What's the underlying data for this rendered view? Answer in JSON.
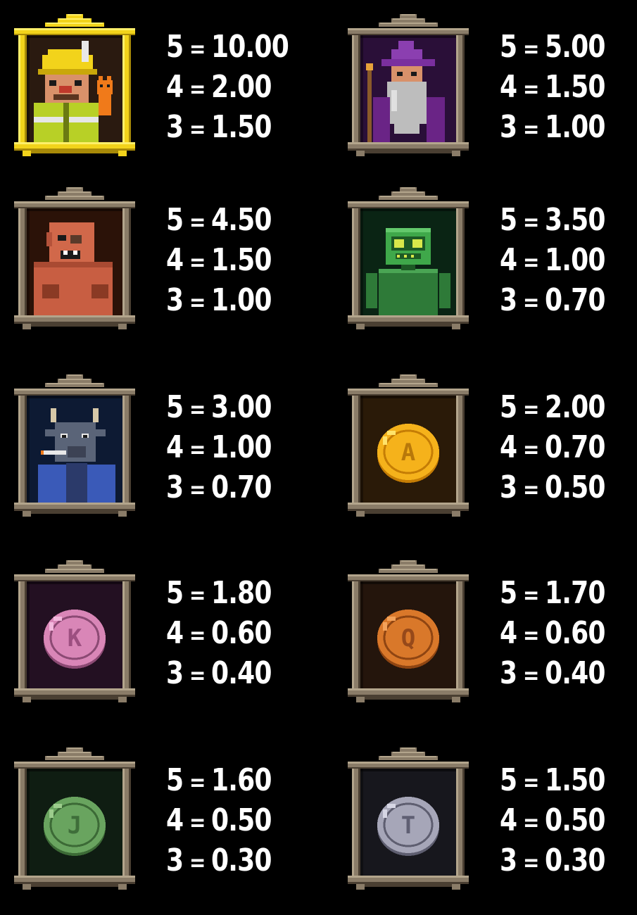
{
  "colors": {
    "background": "#000000",
    "text": "#ffffff",
    "frame_wood": "#8a7c68",
    "frame_wood_light": "#b3a58c",
    "frame_wood_dark": "#4a3f32",
    "frame_gold": "#f2d31b",
    "frame_gold_light": "#fff06a",
    "frame_gold_dark": "#a88a08"
  },
  "symbols": [
    {
      "id": "firefighter",
      "icon": "firefighter-with-cat-portrait",
      "frame": "gold",
      "panel_color": "#2a1a10",
      "pays": [
        {
          "count": "5",
          "eq": "=",
          "amount": "10.00"
        },
        {
          "count": "4",
          "eq": "=",
          "amount": "2.00"
        },
        {
          "count": "3",
          "eq": "=",
          "amount": "1.50"
        }
      ]
    },
    {
      "id": "wizard",
      "icon": "wizard-portrait",
      "frame": "wood",
      "panel_color": "#2a0f38",
      "pays": [
        {
          "count": "5",
          "eq": "=",
          "amount": "5.00"
        },
        {
          "count": "4",
          "eq": "=",
          "amount": "1.50"
        },
        {
          "count": "3",
          "eq": "=",
          "amount": "1.00"
        }
      ]
    },
    {
      "id": "ogre",
      "icon": "ogre-portrait",
      "frame": "wood",
      "panel_color": "#2b1208",
      "pays": [
        {
          "count": "5",
          "eq": "=",
          "amount": "4.50"
        },
        {
          "count": "4",
          "eq": "=",
          "amount": "1.50"
        },
        {
          "count": "3",
          "eq": "=",
          "amount": "1.00"
        }
      ]
    },
    {
      "id": "robot",
      "icon": "green-robot-portrait",
      "frame": "wood",
      "panel_color": "#0a2414",
      "pays": [
        {
          "count": "5",
          "eq": "=",
          "amount": "3.50"
        },
        {
          "count": "4",
          "eq": "=",
          "amount": "1.00"
        },
        {
          "count": "3",
          "eq": "=",
          "amount": "0.70"
        }
      ]
    },
    {
      "id": "goat",
      "icon": "goat-with-cigar-portrait",
      "frame": "wood",
      "panel_color": "#0d1a33",
      "pays": [
        {
          "count": "5",
          "eq": "=",
          "amount": "3.00"
        },
        {
          "count": "4",
          "eq": "=",
          "amount": "1.00"
        },
        {
          "count": "3",
          "eq": "=",
          "amount": "0.70"
        }
      ]
    },
    {
      "id": "coin-a",
      "icon": "gold-coin-a-icon",
      "frame": "wood",
      "panel_color": "#2a1a08",
      "coin": {
        "letter": "A",
        "fill": "#f5b21b",
        "rim": "#c57d05",
        "shine": "#ffe36a",
        "letter_color": "#b8780a"
      },
      "pays": [
        {
          "count": "5",
          "eq": "=",
          "amount": "2.00"
        },
        {
          "count": "4",
          "eq": "=",
          "amount": "0.70"
        },
        {
          "count": "3",
          "eq": "=",
          "amount": "0.50"
        }
      ]
    },
    {
      "id": "coin-k",
      "icon": "pink-coin-k-icon",
      "frame": "wood",
      "panel_color": "#231022",
      "coin": {
        "letter": "K",
        "fill": "#d986b7",
        "rim": "#8c4a74",
        "shine": "#f3b8dd",
        "letter_color": "#9c4f80"
      },
      "pays": [
        {
          "count": "5",
          "eq": "=",
          "amount": "1.80"
        },
        {
          "count": "4",
          "eq": "=",
          "amount": "0.60"
        },
        {
          "count": "3",
          "eq": "=",
          "amount": "0.40"
        }
      ]
    },
    {
      "id": "coin-q",
      "icon": "bronze-coin-q-icon",
      "frame": "wood",
      "panel_color": "#24150c",
      "coin": {
        "letter": "Q",
        "fill": "#d9782a",
        "rim": "#8f4512",
        "shine": "#f3a25a",
        "letter_color": "#96491a"
      },
      "pays": [
        {
          "count": "5",
          "eq": "=",
          "amount": "1.70"
        },
        {
          "count": "4",
          "eq": "=",
          "amount": "0.60"
        },
        {
          "count": "3",
          "eq": "=",
          "amount": "0.40"
        }
      ]
    },
    {
      "id": "coin-j",
      "icon": "green-coin-j-icon",
      "frame": "wood",
      "panel_color": "#0f1d12",
      "coin": {
        "letter": "J",
        "fill": "#69a45f",
        "rim": "#3c6a36",
        "shine": "#9ccc8c",
        "letter_color": "#3f6e3a"
      },
      "pays": [
        {
          "count": "5",
          "eq": "=",
          "amount": "1.60"
        },
        {
          "count": "4",
          "eq": "=",
          "amount": "0.50"
        },
        {
          "count": "3",
          "eq": "=",
          "amount": "0.30"
        }
      ]
    },
    {
      "id": "coin-t",
      "icon": "silver-coin-t-icon",
      "frame": "wood",
      "panel_color": "#17171d",
      "coin": {
        "letter": "T",
        "fill": "#a6a6b8",
        "rim": "#5e5e70",
        "shine": "#d6d6e4",
        "letter_color": "#5f5f73"
      },
      "pays": [
        {
          "count": "5",
          "eq": "=",
          "amount": "1.50"
        },
        {
          "count": "4",
          "eq": "=",
          "amount": "0.50"
        },
        {
          "count": "3",
          "eq": "=",
          "amount": "0.30"
        }
      ]
    }
  ]
}
